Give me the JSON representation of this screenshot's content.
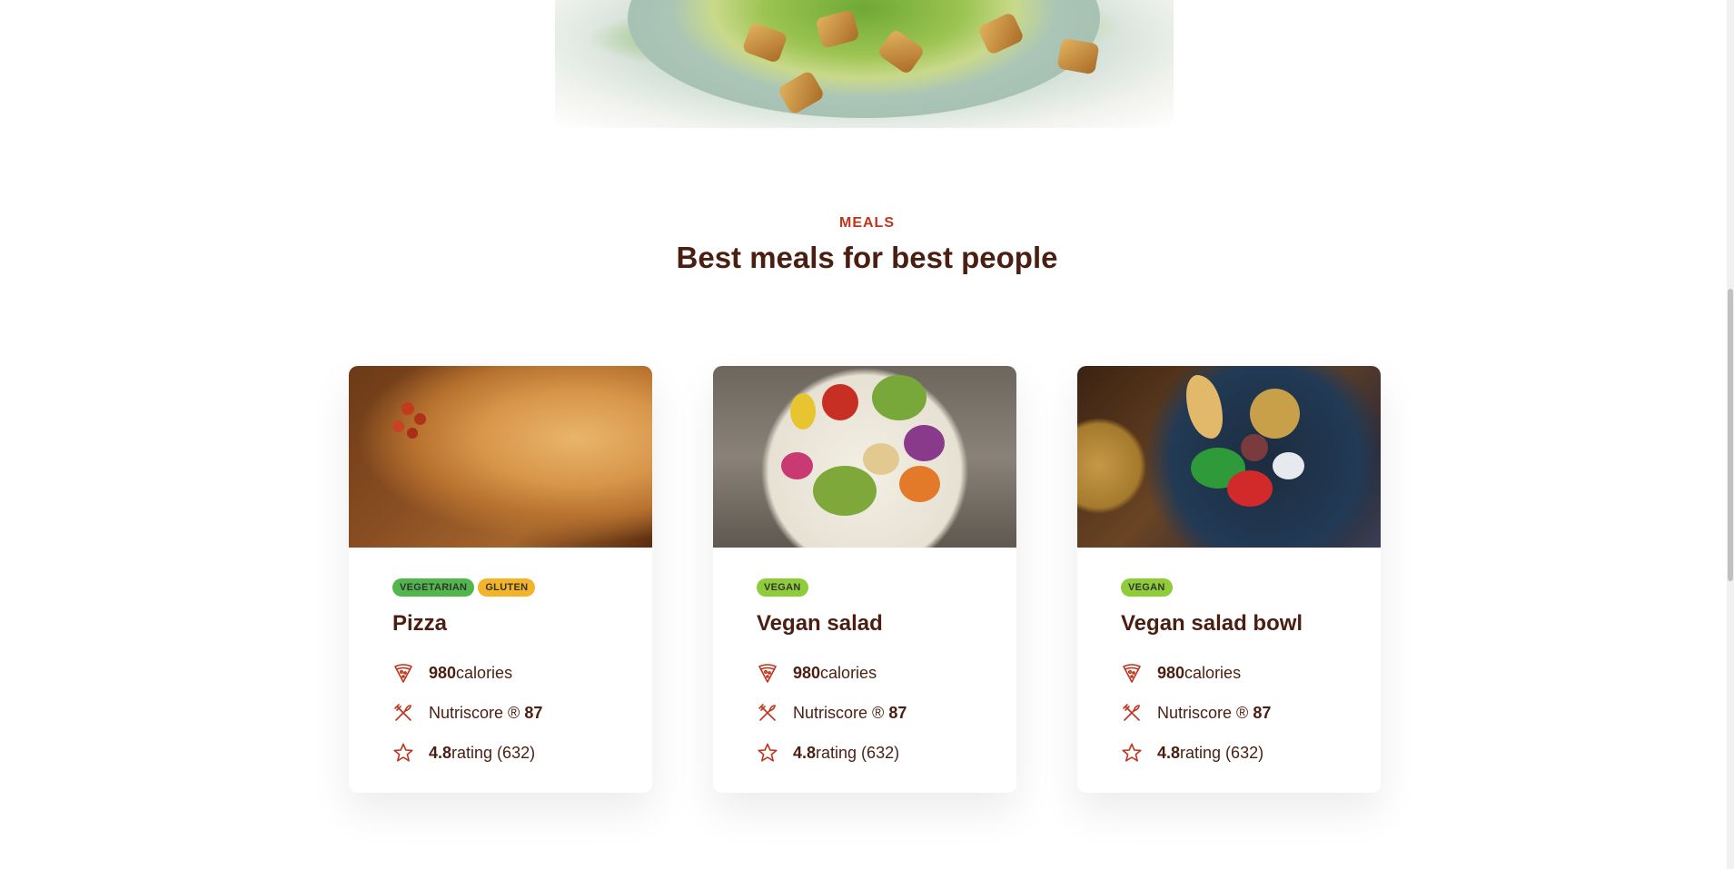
{
  "section": {
    "label": "MEALS",
    "title": "Best meals for best people"
  },
  "meals": [
    {
      "name": "Pizza",
      "tags": [
        "VEGETARIAN",
        "GLUTEN"
      ],
      "calories_value": "980",
      "calories_unit": "calories",
      "nutriscore_label": "Nutriscore ®",
      "nutriscore_value": "87",
      "rating_value": "4.8",
      "rating_label": "rating (632)"
    },
    {
      "name": "Vegan salad",
      "tags": [
        "VEGAN"
      ],
      "calories_value": "980",
      "calories_unit": "calories",
      "nutriscore_label": "Nutriscore ®",
      "nutriscore_value": "87",
      "rating_value": "4.8",
      "rating_label": "rating (632)"
    },
    {
      "name": "Vegan salad bowl",
      "tags": [
        "VEGAN"
      ],
      "calories_value": "980",
      "calories_unit": "calories",
      "nutriscore_label": "Nutriscore ®",
      "nutriscore_value": "87",
      "rating_value": "4.8",
      "rating_label": "rating (632)"
    }
  ],
  "icons": {
    "calories": "pizza-slice-icon",
    "nutriscore": "fork-knife-icon",
    "rating": "star-icon"
  },
  "colors": {
    "accent": "#c0341d",
    "heading": "#4a1f12",
    "tag_vegetarian": "#51b74d",
    "tag_gluten": "#f4b42a",
    "tag_vegan": "#8fcc3a"
  }
}
